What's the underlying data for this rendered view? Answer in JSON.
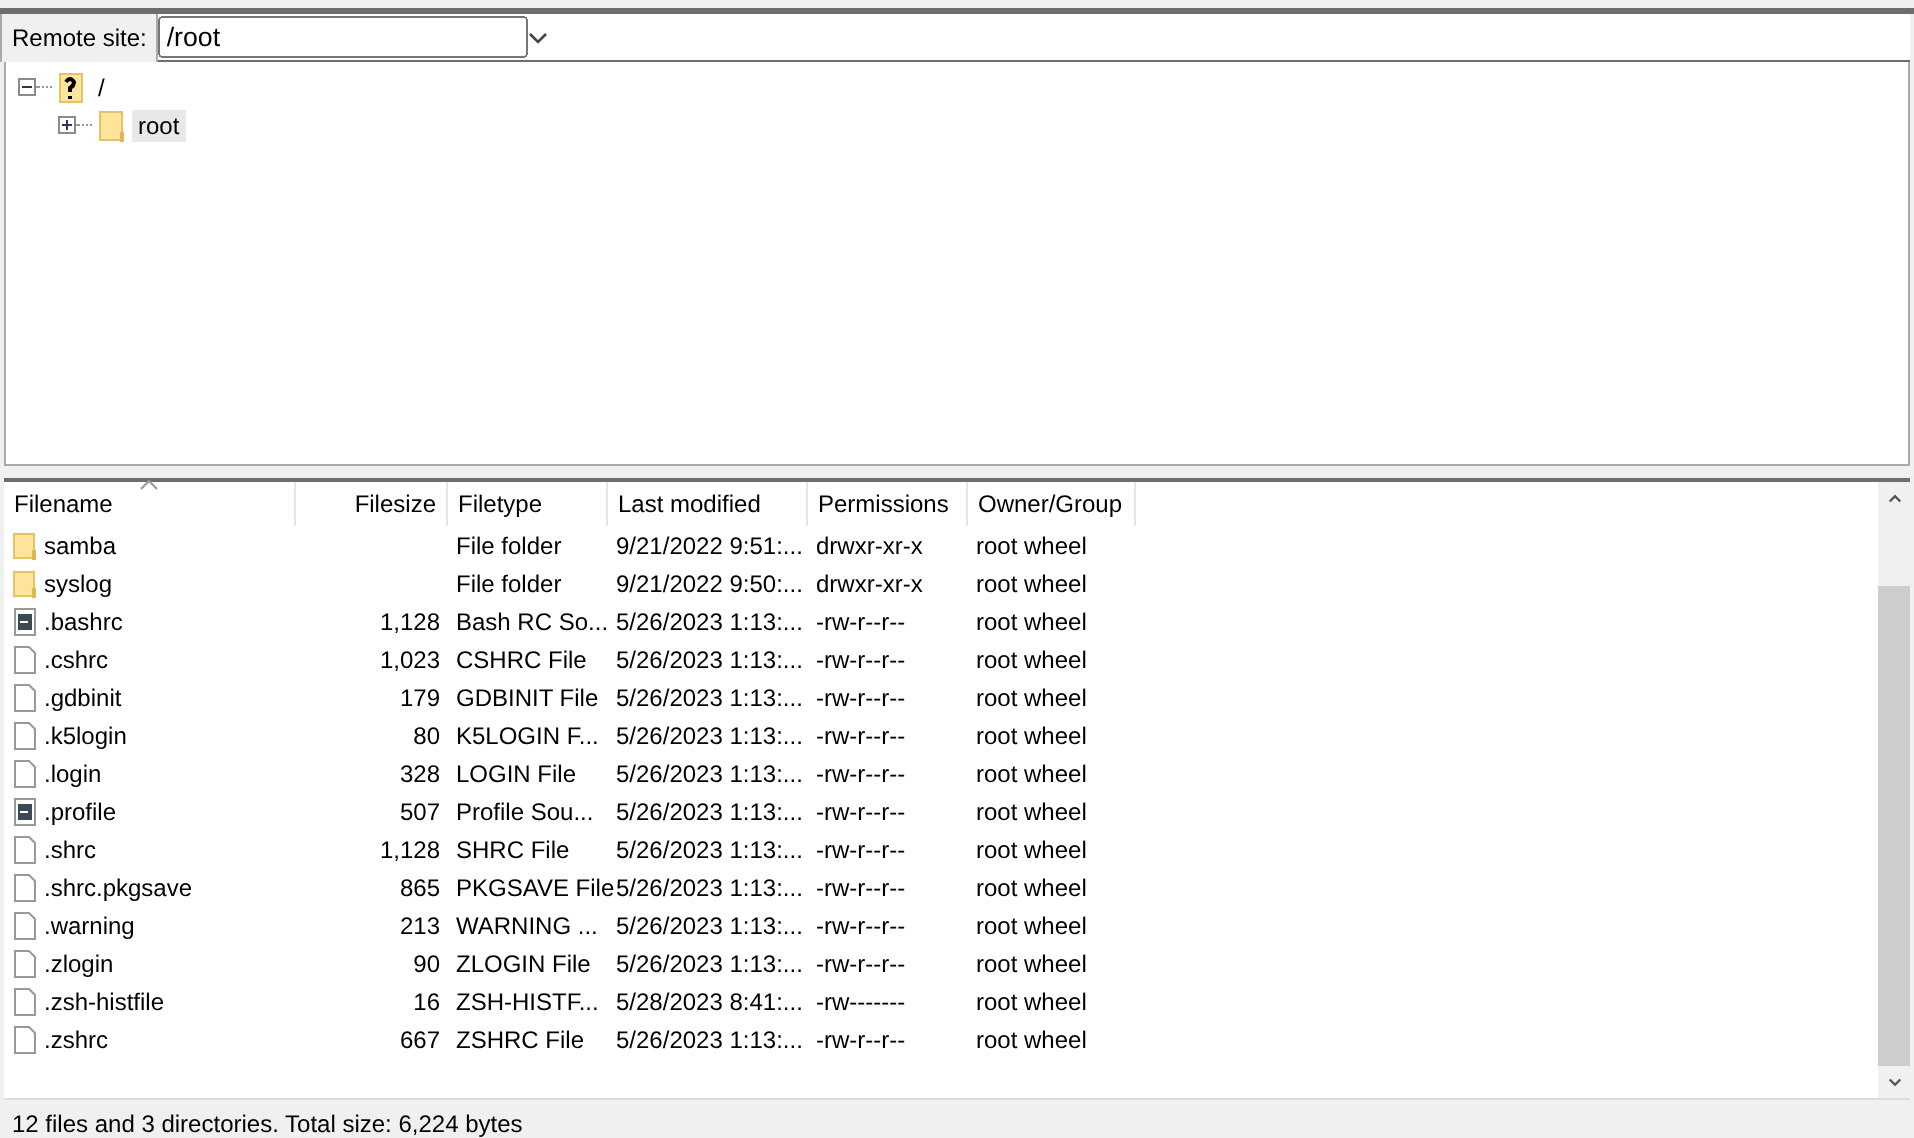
{
  "remote_site": {
    "label": "Remote site:",
    "value": "/root"
  },
  "tree": [
    {
      "label": "/",
      "kind": "unknown",
      "expanded": true,
      "selected": false,
      "children": [
        {
          "label": "root",
          "kind": "folder",
          "expanded": false,
          "selected": true
        }
      ]
    }
  ],
  "file_list": {
    "columns": [
      {
        "label": "Filename",
        "sorted": true
      },
      {
        "label": "Filesize",
        "sorted": false
      },
      {
        "label": "Filetype",
        "sorted": false
      },
      {
        "label": "Last modified",
        "sorted": false
      },
      {
        "label": "Permissions",
        "sorted": false
      },
      {
        "label": "Owner/Group",
        "sorted": false
      }
    ],
    "rows": [
      {
        "kind": "folder",
        "cells": [
          "samba",
          "",
          "File folder",
          "9/21/2022 9:51:...",
          "drwxr-xr-x",
          "root wheel"
        ]
      },
      {
        "kind": "folder",
        "cells": [
          "syslog",
          "",
          "File folder",
          "9/21/2022 9:50:...",
          "drwxr-xr-x",
          "root wheel"
        ]
      },
      {
        "kind": "script",
        "cells": [
          ".bashrc",
          "1,128",
          "Bash RC So...",
          "5/26/2023 1:13:...",
          "-rw-r--r--",
          "root wheel"
        ]
      },
      {
        "kind": "file",
        "cells": [
          ".cshrc",
          "1,023",
          "CSHRC File",
          "5/26/2023 1:13:...",
          "-rw-r--r--",
          "root wheel"
        ]
      },
      {
        "kind": "file",
        "cells": [
          ".gdbinit",
          "179",
          "GDBINIT File",
          "5/26/2023 1:13:...",
          "-rw-r--r--",
          "root wheel"
        ]
      },
      {
        "kind": "file",
        "cells": [
          ".k5login",
          "80",
          "K5LOGIN F...",
          "5/26/2023 1:13:...",
          "-rw-r--r--",
          "root wheel"
        ]
      },
      {
        "kind": "file",
        "cells": [
          ".login",
          "328",
          "LOGIN File",
          "5/26/2023 1:13:...",
          "-rw-r--r--",
          "root wheel"
        ]
      },
      {
        "kind": "script",
        "cells": [
          ".profile",
          "507",
          "Profile Sou...",
          "5/26/2023 1:13:...",
          "-rw-r--r--",
          "root wheel"
        ]
      },
      {
        "kind": "file",
        "cells": [
          ".shrc",
          "1,128",
          "SHRC File",
          "5/26/2023 1:13:...",
          "-rw-r--r--",
          "root wheel"
        ]
      },
      {
        "kind": "file",
        "cells": [
          ".shrc.pkgsave",
          "865",
          "PKGSAVE File",
          "5/26/2023 1:13:...",
          "-rw-r--r--",
          "root wheel"
        ]
      },
      {
        "kind": "file",
        "cells": [
          ".warning",
          "213",
          "WARNING ...",
          "5/26/2023 1:13:...",
          "-rw-r--r--",
          "root wheel"
        ]
      },
      {
        "kind": "file",
        "cells": [
          ".zlogin",
          "90",
          "ZLOGIN File",
          "5/26/2023 1:13:...",
          "-rw-r--r--",
          "root wheel"
        ]
      },
      {
        "kind": "file",
        "cells": [
          ".zsh-histfile",
          "16",
          "ZSH-HISTF...",
          "5/28/2023 8:41:...",
          "-rw-------",
          "root wheel"
        ]
      },
      {
        "kind": "file",
        "cells": [
          ".zshrc",
          "667",
          "ZSHRC File",
          "5/26/2023 1:13:...",
          "-rw-r--r--",
          "root wheel"
        ]
      }
    ]
  },
  "status_bar": "12 files and 3 directories. Total size: 6,224 bytes"
}
